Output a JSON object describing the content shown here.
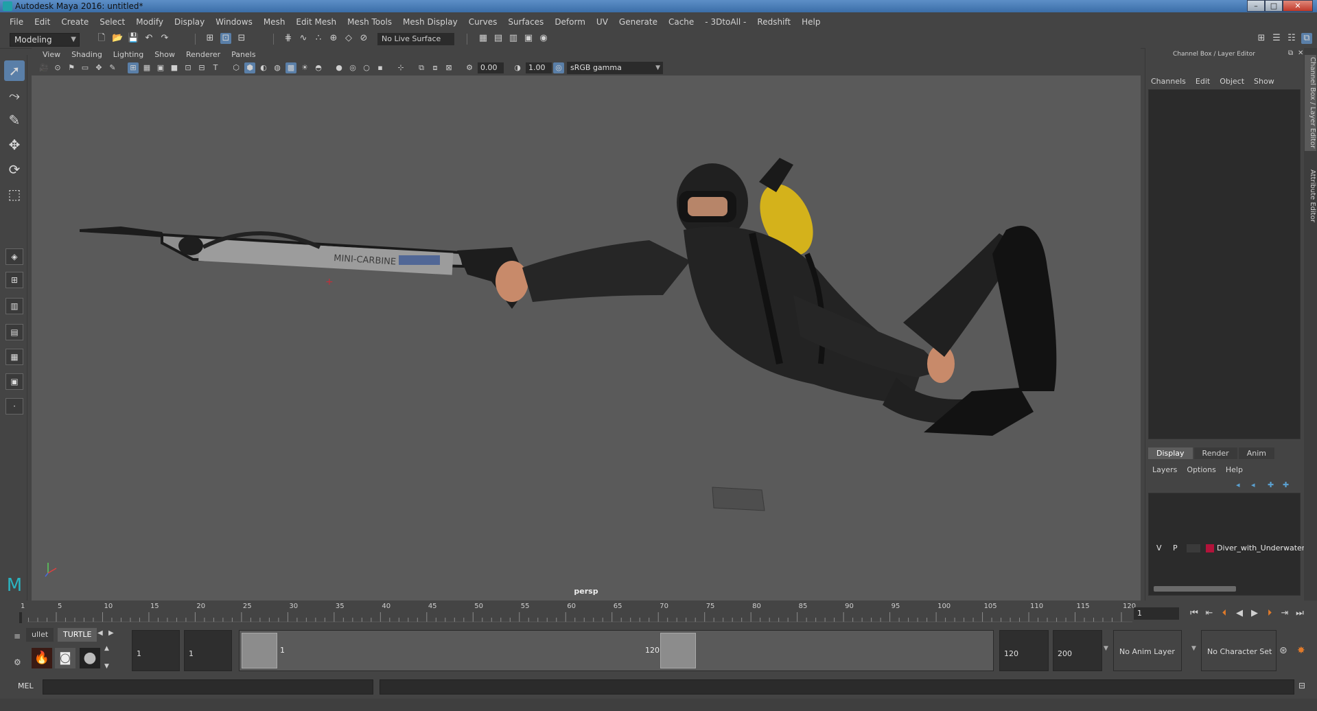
{
  "window": {
    "title": "Autodesk Maya 2016: untitled*",
    "minimize": "–",
    "maximize": "□",
    "close": "✕"
  },
  "menubar": [
    "File",
    "Edit",
    "Create",
    "Select",
    "Modify",
    "Display",
    "Windows",
    "Mesh",
    "Edit Mesh",
    "Mesh Tools",
    "Mesh Display",
    "Curves",
    "Surfaces",
    "Deform",
    "UV",
    "Generate",
    "Cache",
    "- 3DtoAll -",
    "Redshift",
    "Help"
  ],
  "statusline": {
    "mode": "Modeling",
    "live_surface": "No Live Surface"
  },
  "viewport": {
    "menus": [
      "View",
      "Shading",
      "Lighting",
      "Show",
      "Renderer",
      "Panels"
    ],
    "exposure": "0.00",
    "gamma": "1.00",
    "color_space": "sRGB gamma",
    "camera_label": "persp",
    "speargun_text": "MINI-CARBINE"
  },
  "channelbox": {
    "title": "Channel Box / Layer Editor",
    "tabs": [
      "Channels",
      "Edit",
      "Object",
      "Show"
    ],
    "layer_tabs": [
      "Display",
      "Render",
      "Anim"
    ],
    "layer_menu": [
      "Layers",
      "Options",
      "Help"
    ],
    "layer": {
      "v": "V",
      "p": "P",
      "name": "Diver_with_Underwater_",
      "color": "#b2133a"
    }
  },
  "side_tabs": [
    "Channel Box / Layer Editor",
    "Attribute Editor"
  ],
  "timeslider": {
    "ticks": [
      "1",
      "5",
      "10",
      "15",
      "20",
      "25",
      "30",
      "35",
      "40",
      "45",
      "50",
      "55",
      "60",
      "65",
      "70",
      "75",
      "80",
      "85",
      "90",
      "95",
      "100",
      "105",
      "110",
      "115",
      "120"
    ],
    "current_frame": "1"
  },
  "shelf": {
    "tabs": [
      "ullet",
      "TURTLE"
    ]
  },
  "range": {
    "start": "1",
    "playback_start": "1",
    "range_start_label": "1",
    "range_end_label": "120",
    "playback_end": "120",
    "end": "200",
    "anim_layer": "No Anim Layer",
    "character_set": "No Character Set"
  },
  "cmdline": {
    "label": "MEL"
  }
}
